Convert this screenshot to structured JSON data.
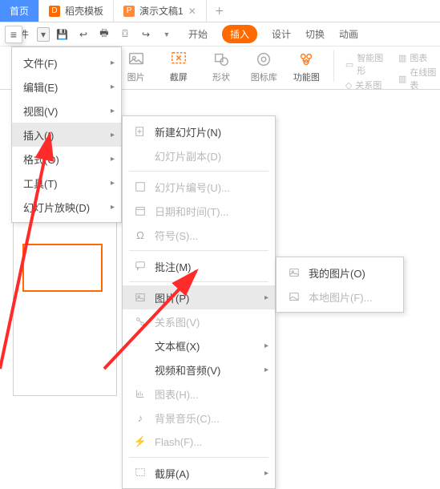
{
  "tabs": {
    "home": "首页",
    "t1": "稻壳模板",
    "t2": "演示文稿1"
  },
  "quick": {
    "file": "文件"
  },
  "ribbon_tabs": {
    "start": "开始",
    "insert": "插入",
    "design": "设计",
    "transition": "切换",
    "anim": "动画"
  },
  "ribbon": {
    "pic": "图片",
    "screenshot": "截屏",
    "shape": "形状",
    "iconlib": "图标库",
    "effects": "功能图",
    "smartart": "智能图形",
    "chart": "图表",
    "relation": "关系图",
    "online_chart": "在线图表"
  },
  "menu1": {
    "file": "文件(F)",
    "edit": "编辑(E)",
    "view": "视图(V)",
    "insert": "插入(I)",
    "format": "格式(O)",
    "tool": "工具(T)",
    "slideshow": "幻灯片放映(D)"
  },
  "menu2": {
    "newslide": "新建幻灯片(N)",
    "dupslide": "幻灯片副本(D)",
    "slidenum": "幻灯片编号(U)...",
    "datetime": "日期和时间(T)...",
    "symbol": "符号(S)...",
    "comment": "批注(M)",
    "picture": "图片(P)",
    "relation": "关系图(V)",
    "textbox": "文本框(X)",
    "media": "视频和音频(V)",
    "chart": "图表(H)...",
    "bgmusic": "背景音乐(C)...",
    "flash": "Flash(F)...",
    "screenshot": "截屏(A)"
  },
  "menu3": {
    "mypic": "我的图片(O)",
    "localpic": "本地图片(F)..."
  }
}
